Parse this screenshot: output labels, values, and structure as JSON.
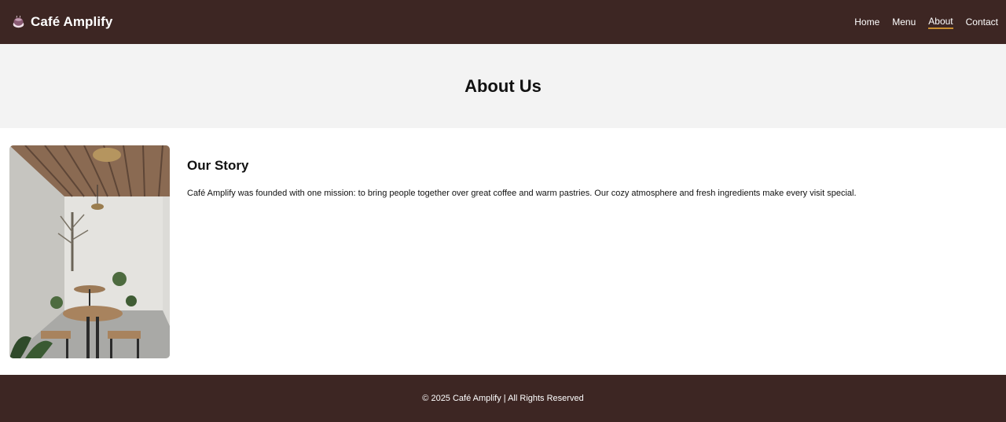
{
  "header": {
    "brand_icon": "coffee-cup-icon",
    "brand_name": "Café Amplify",
    "nav": [
      {
        "label": "Home",
        "active": false
      },
      {
        "label": "Menu",
        "active": false
      },
      {
        "label": "About",
        "active": true
      },
      {
        "label": "Contact",
        "active": false
      }
    ]
  },
  "hero": {
    "title": "About Us"
  },
  "story": {
    "image": "cafe-interior-photo",
    "heading": "Our Story",
    "body": "Café Amplify was founded with one mission: to bring people together over great coffee and warm pastries. Our cozy atmosphere and fresh ingredients make every visit special."
  },
  "footer": {
    "text": "© 2025 Café Amplify | All Rights Reserved"
  },
  "colors": {
    "header_bg": "#3d2623",
    "hero_bg": "#f3f3f3",
    "active_underline": "#c98f2f",
    "footer_bg": "#3d2623"
  }
}
